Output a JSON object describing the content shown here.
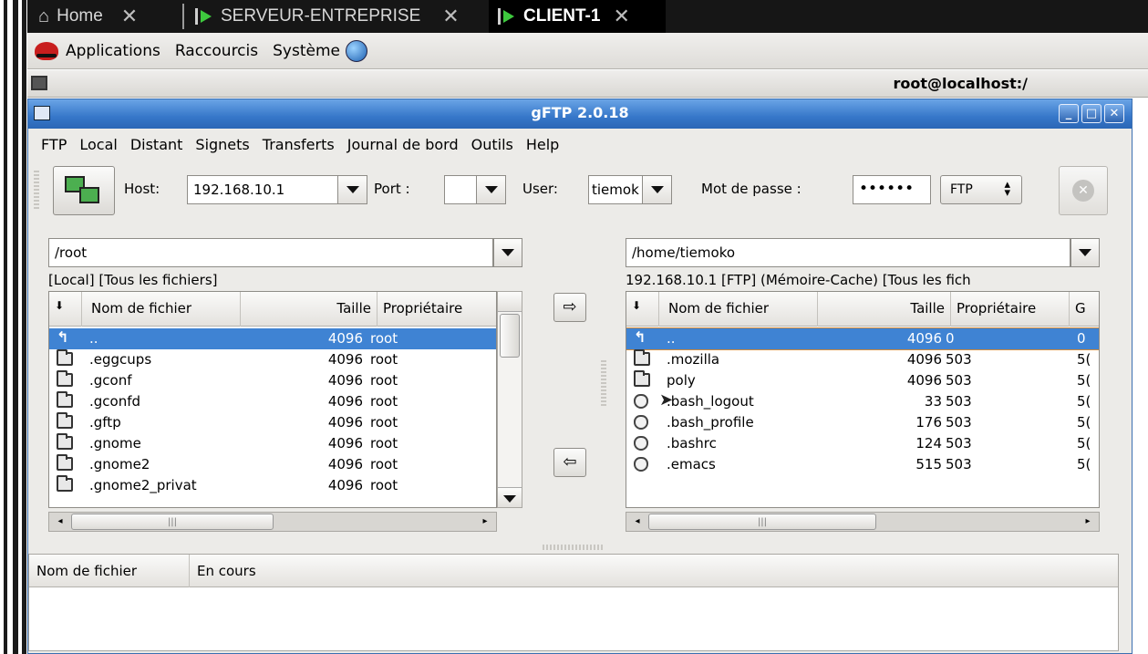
{
  "vm_tabs": [
    {
      "label": "Home",
      "close": "✕",
      "active": false
    },
    {
      "label": "SERVEUR-ENTREPRISE",
      "close": "✕",
      "active": false
    },
    {
      "label": "CLIENT-1",
      "close": "✕",
      "active": true
    }
  ],
  "panel": {
    "applications": "Applications",
    "shortcuts": "Raccourcis",
    "system": "Système"
  },
  "terminal": {
    "title": "root@localhost:/"
  },
  "gftp": {
    "title": "gFTP 2.0.18",
    "window_buttons": {
      "minimize": "_",
      "maximize": "□",
      "close": "✕"
    },
    "menu": [
      "FTP",
      "Local",
      "Distant",
      "Signets",
      "Transferts",
      "Journal de bord",
      "Outils",
      "Help"
    ],
    "toolbar": {
      "host_label": "Host:",
      "host_value": "192.168.10.1",
      "port_label": "Port :",
      "port_value": "",
      "user_label": "User:",
      "user_value": "tiemok",
      "password_label": "Mot de passe :",
      "password_value": "••••••",
      "protocol": "FTP"
    },
    "local": {
      "path": "/root",
      "status": "[Local] [Tous les fichiers]",
      "columns": [
        "Nom de fichier",
        "Taille",
        "Propriétaire"
      ],
      "rows": [
        {
          "icon": "up-dir-icon",
          "name": "..",
          "size": "4096",
          "owner": "root",
          "selected": true
        },
        {
          "icon": "folder-icon",
          "name": ".eggcups",
          "size": "4096",
          "owner": "root"
        },
        {
          "icon": "folder-icon",
          "name": ".gconf",
          "size": "4096",
          "owner": "root"
        },
        {
          "icon": "folder-icon",
          "name": ".gconfd",
          "size": "4096",
          "owner": "root"
        },
        {
          "icon": "folder-icon",
          "name": ".gftp",
          "size": "4096",
          "owner": "root"
        },
        {
          "icon": "folder-icon",
          "name": ".gnome",
          "size": "4096",
          "owner": "root"
        },
        {
          "icon": "folder-icon",
          "name": ".gnome2",
          "size": "4096",
          "owner": "root"
        },
        {
          "icon": "folder-icon",
          "name": ".gnome2_privat",
          "size": "4096",
          "owner": "root"
        }
      ]
    },
    "remote": {
      "path": "/home/tiemoko",
      "status": "192.168.10.1 [FTP] (Mémoire-Cache) [Tous les fich",
      "columns": [
        "Nom de fichier",
        "Taille",
        "Propriétaire",
        "G"
      ],
      "rows": [
        {
          "icon": "up-dir-icon",
          "name": "..",
          "size": "4096",
          "owner": "0",
          "group": "0",
          "selected": true
        },
        {
          "icon": "folder-icon",
          "name": ".mozilla",
          "size": "4096",
          "owner": "503",
          "group": "5("
        },
        {
          "icon": "folder-icon",
          "name": "poly",
          "size": "4096",
          "owner": "503",
          "group": "5("
        },
        {
          "icon": "file-icon",
          "name": ".bash_logout",
          "size": "33",
          "owner": "503",
          "group": "5("
        },
        {
          "icon": "file-icon",
          "name": ".bash_profile",
          "size": "176",
          "owner": "503",
          "group": "5("
        },
        {
          "icon": "file-icon",
          "name": ".bashrc",
          "size": "124",
          "owner": "503",
          "group": "5("
        },
        {
          "icon": "file-icon",
          "name": ".emacs",
          "size": "515",
          "owner": "503",
          "group": "5("
        }
      ]
    },
    "transfer_buttons": {
      "upload": "⇨",
      "download": "⇦"
    },
    "queue": {
      "columns": [
        "Nom de fichier",
        "En cours"
      ]
    }
  },
  "colors": {
    "titlebar": "#3677c9",
    "selection": "#3f83d3",
    "window_bg": "#ecebe8"
  }
}
